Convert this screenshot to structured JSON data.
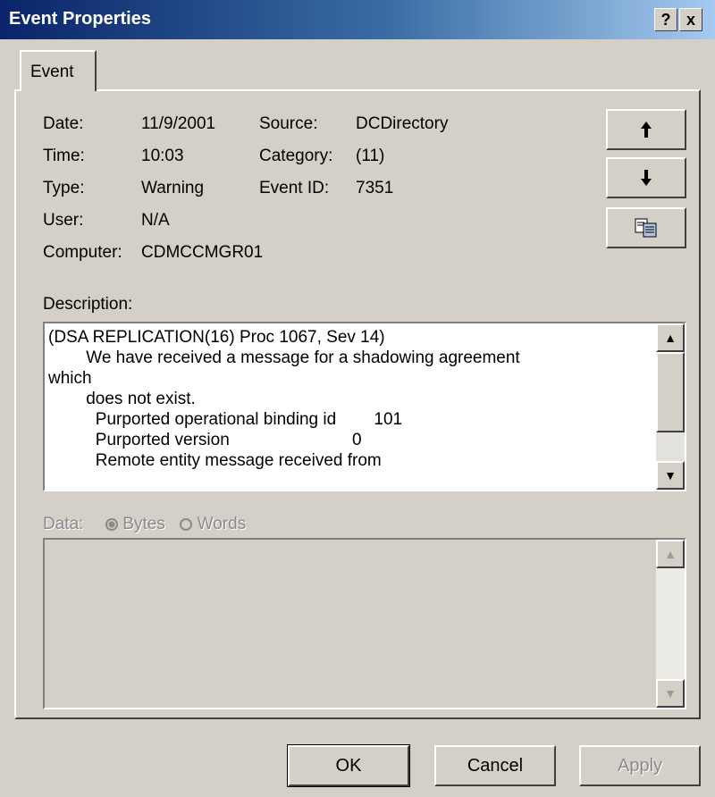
{
  "window": {
    "title": "Event Properties",
    "help_label": "?",
    "close_label": "x"
  },
  "tabs": [
    {
      "label": "Event"
    }
  ],
  "details": {
    "date_label": "Date:",
    "date_value": "11/9/2001",
    "time_label": "Time:",
    "time_value": "10:03",
    "type_label": "Type:",
    "type_value": "Warning",
    "user_label": "User:",
    "user_value": "N/A",
    "computer_label": "Computer:",
    "computer_value": "CDMCCMGR01",
    "source_label": "Source:",
    "source_value": "DCDirectory",
    "category_label": "Category:",
    "category_value": "(11)",
    "event_id_label": "Event ID:",
    "event_id_value": "7351"
  },
  "nav_buttons": {
    "up_icon": "arrow-up-icon",
    "down_icon": "arrow-down-icon",
    "copy_icon": "copy-icon"
  },
  "description": {
    "label": "Description:",
    "text": "(DSA REPLICATION(16) Proc 1067, Sev 14)\n        We have received a message for a shadowing agreement\nwhich\n        does not exist.\n          Purported operational binding id        101\n          Purported version                          0\n          Remote entity message received from"
  },
  "data_section": {
    "label": "Data:",
    "bytes_label": "Bytes",
    "words_label": "Words",
    "selected": "Bytes"
  },
  "buttons": {
    "ok": "OK",
    "cancel": "Cancel",
    "apply": "Apply"
  }
}
